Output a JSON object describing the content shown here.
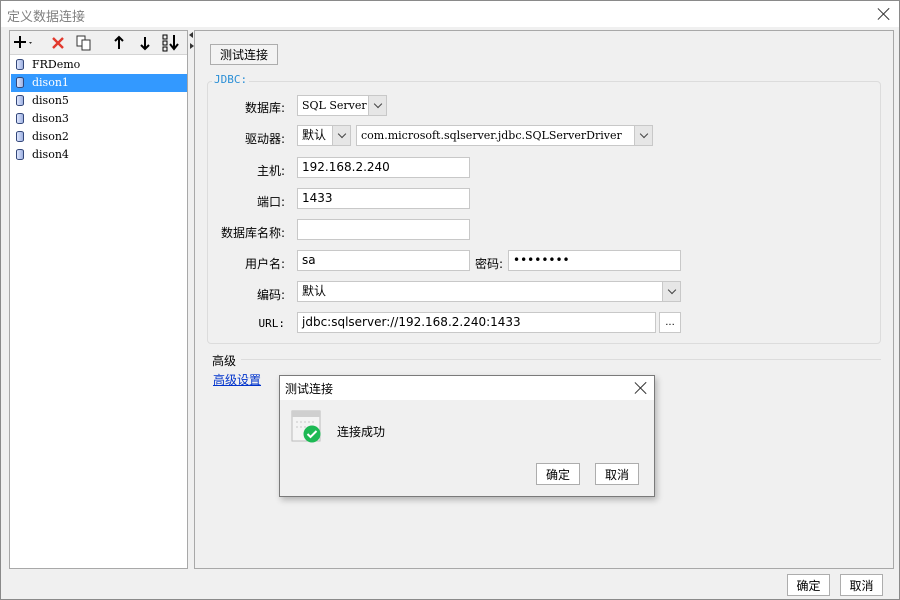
{
  "window": {
    "title": "定义数据连接",
    "ok_label": "确定",
    "cancel_label": "取消"
  },
  "toolbar": {
    "icons": [
      "add-icon",
      "delete-icon",
      "copy-icon",
      "move-up-icon",
      "move-down-icon",
      "sort-icon"
    ]
  },
  "connections": [
    "FRDemo",
    "dison1",
    "dison5",
    "dison3",
    "dison2",
    "dison4"
  ],
  "selected_connection": "dison1",
  "test_button_label": "测试连接",
  "jdbc": {
    "legend": "JDBC:",
    "database_label": "数据库:",
    "database_value": "SQL Server",
    "driver_label": "驱动器:",
    "driver_mode": "默认",
    "driver_class": "com.microsoft.sqlserver.jdbc.SQLServerDriver",
    "host_label": "主机:",
    "host_value": "192.168.2.240",
    "port_label": "端口:",
    "port_value": "1433",
    "dbname_label": "数据库名称:",
    "dbname_value": "",
    "user_label": "用户名:",
    "user_value": "sa",
    "password_label": "密码:",
    "password_value": "••••••••",
    "encoding_label": "编码:",
    "encoding_value": "默认",
    "url_label": "URL:",
    "url_value": "jdbc:sqlserver://192.168.2.240:1433",
    "url_browse": "..."
  },
  "advanced": {
    "title": "高级",
    "link": "高级设置"
  },
  "dialog": {
    "title": "测试连接",
    "message": "连接成功",
    "ok_label": "确定",
    "cancel_label": "取消"
  },
  "colors": {
    "selection": "#3399ff",
    "link": "#0033cc",
    "legend": "#2b8fd6",
    "success": "#1db954"
  }
}
